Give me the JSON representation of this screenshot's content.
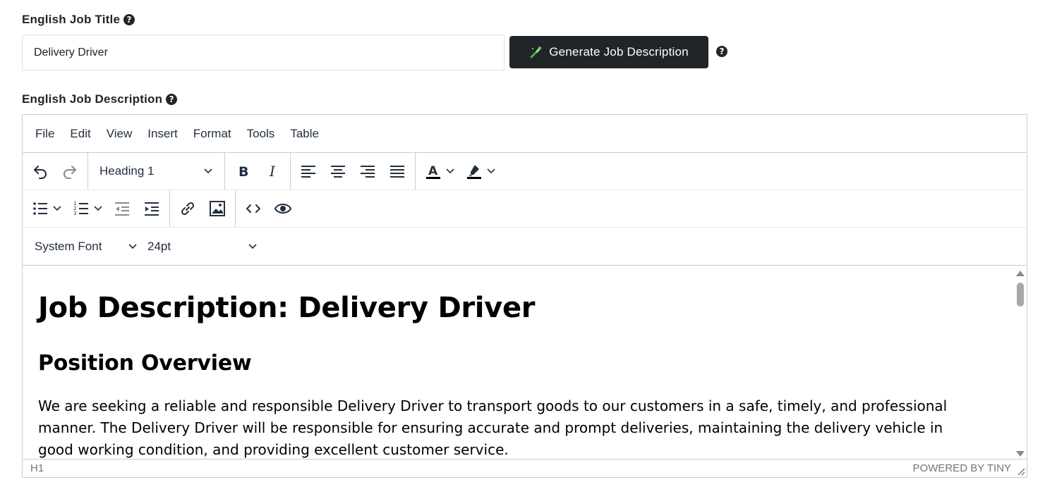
{
  "title_field": {
    "label": "English Job Title",
    "value": "Delivery Driver",
    "help": "?"
  },
  "generate_button": {
    "label": "Generate Job Description",
    "help": "?"
  },
  "description_field": {
    "label": "English Job Description",
    "help": "?"
  },
  "editor": {
    "menu": [
      "File",
      "Edit",
      "View",
      "Insert",
      "Format",
      "Tools",
      "Table"
    ],
    "block_format": "Heading 1",
    "font_family": "System Font",
    "font_size": "24pt",
    "content": {
      "heading1": "Job Description: Delivery Driver",
      "heading2": "Position Overview",
      "paragraph": "We are seeking a reliable and responsible Delivery Driver to transport goods to our customers in a safe, timely, and professional manner. The Delivery Driver will be responsible for ensuring accurate and prompt deliveries, maintaining the delivery vehicle in good working condition, and providing excellent customer service."
    },
    "status_path": "H1",
    "branding": "POWERED BY TINY"
  },
  "colors": {
    "button_bg": "#212529",
    "icon": "#222f3e",
    "icon_disabled": "#8a8a8a",
    "border": "#cccccc"
  }
}
